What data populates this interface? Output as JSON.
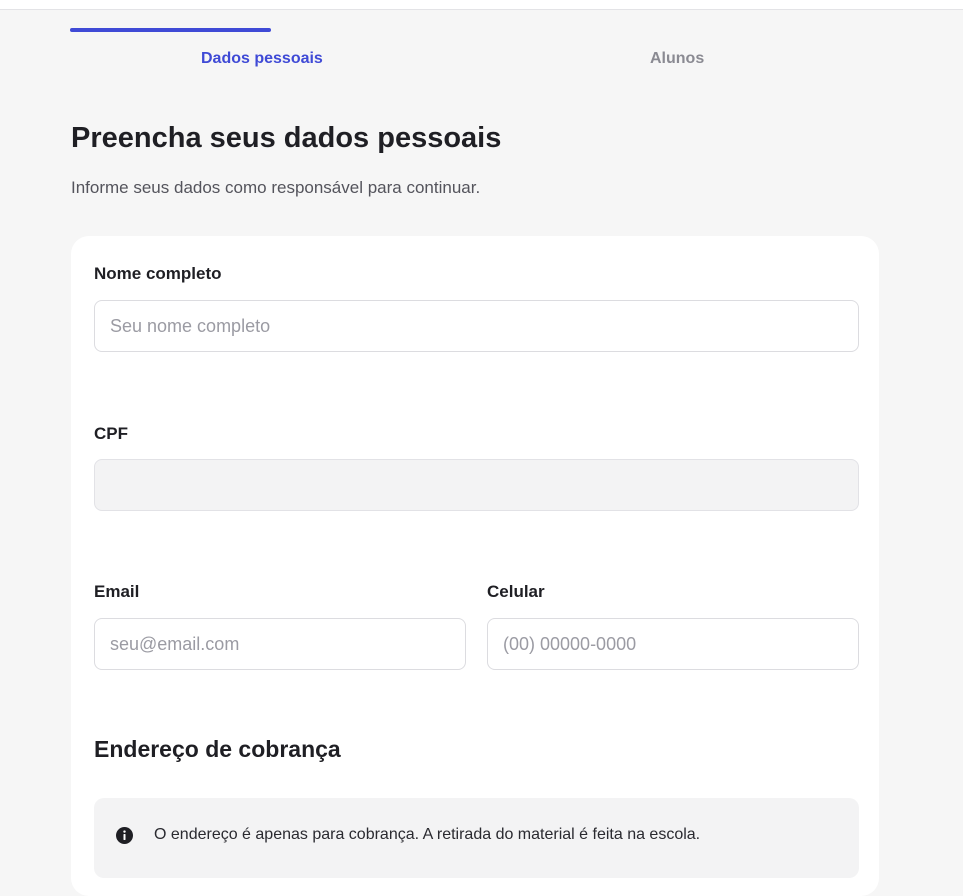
{
  "stepper": {
    "steps": [
      {
        "label": "Dados pessoais",
        "active": true
      },
      {
        "label": "Alunos",
        "active": false
      }
    ],
    "active_color": "#3f4ad6",
    "inactive_color": "#8a8a92"
  },
  "header": {
    "title": "Preencha seus dados pessoais",
    "subtitle": "Informe seus dados como responsável para continuar."
  },
  "form": {
    "full_name": {
      "label": "Nome completo",
      "placeholder": "Seu nome completo",
      "value": ""
    },
    "cpf": {
      "label": "CPF",
      "placeholder": "",
      "value": ""
    },
    "email": {
      "label": "Email",
      "placeholder": "seu@email.com",
      "value": ""
    },
    "phone": {
      "label": "Celular",
      "placeholder": "(00) 00000-0000",
      "value": ""
    }
  },
  "billing": {
    "title": "Endereço de cobrança",
    "notice_icon": "info-icon",
    "notice": "O endereço é apenas para cobrança. A retirada do material é feita na escola."
  }
}
